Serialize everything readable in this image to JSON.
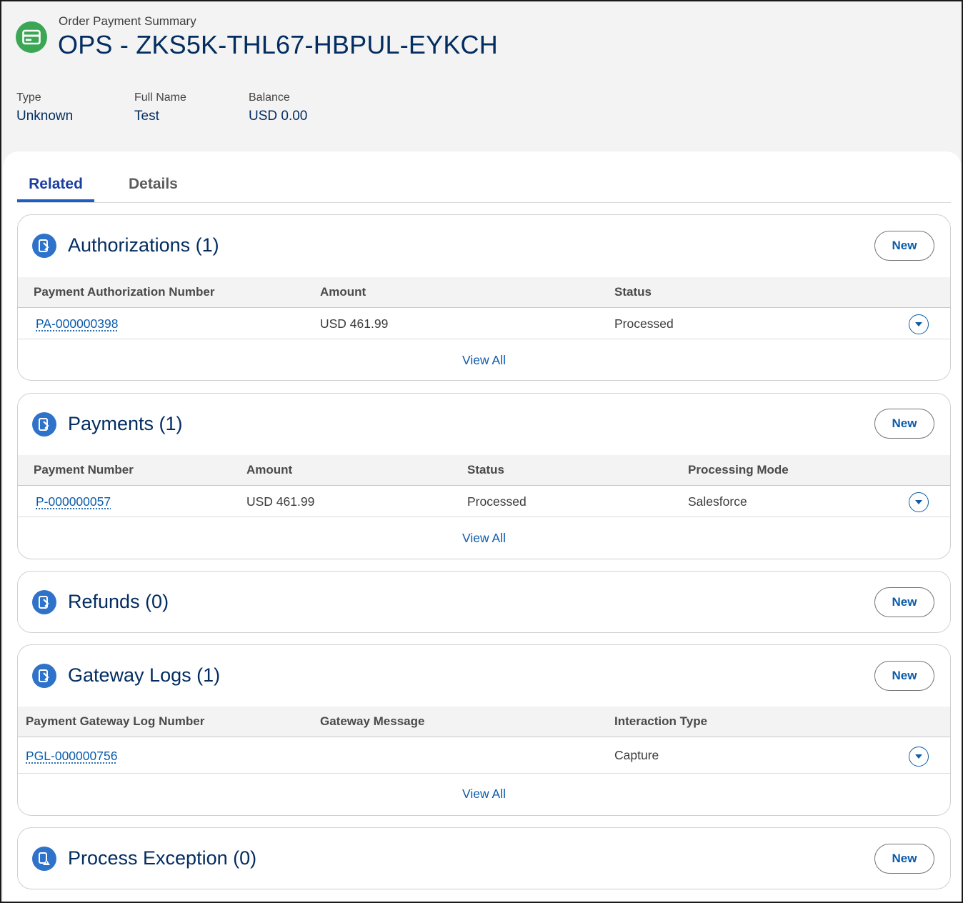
{
  "header": {
    "object_type": "Order Payment Summary",
    "title": "OPS - ZKS5K-THL67-HBPUL-EYKCH",
    "icon": "credit-card-icon",
    "icon_color": "#3ba755",
    "fields": [
      {
        "label": "Type",
        "value": "Unknown"
      },
      {
        "label": "Full Name",
        "value": "Test"
      },
      {
        "label": "Balance",
        "value": "USD 0.00"
      }
    ]
  },
  "tabs": [
    {
      "label": "Related",
      "active": true
    },
    {
      "label": "Details",
      "active": false
    }
  ],
  "accent_color": "#0b5cab",
  "new_label": "New",
  "view_all_label": "View All",
  "related_lists": {
    "authorizations": {
      "title": "Authorizations (1)",
      "columns": [
        "Payment Authorization Number",
        "Amount",
        "Status"
      ],
      "rows": [
        [
          "PA-000000398",
          "USD 461.99",
          "Processed"
        ]
      ]
    },
    "payments": {
      "title": "Payments (1)",
      "columns": [
        "Payment Number",
        "Amount",
        "Status",
        "Processing Mode"
      ],
      "rows": [
        [
          "P-000000057",
          "USD 461.99",
          "Processed",
          "Salesforce"
        ]
      ]
    },
    "refunds": {
      "title": "Refunds (0)"
    },
    "gateway_logs": {
      "title": "Gateway Logs (1)",
      "columns": [
        "Payment Gateway Log Number",
        "Gateway Message",
        "Interaction Type"
      ],
      "rows": [
        [
          "PGL-000000756",
          "",
          "Capture"
        ]
      ]
    },
    "process_exception": {
      "title": "Process Exception (0)"
    }
  }
}
